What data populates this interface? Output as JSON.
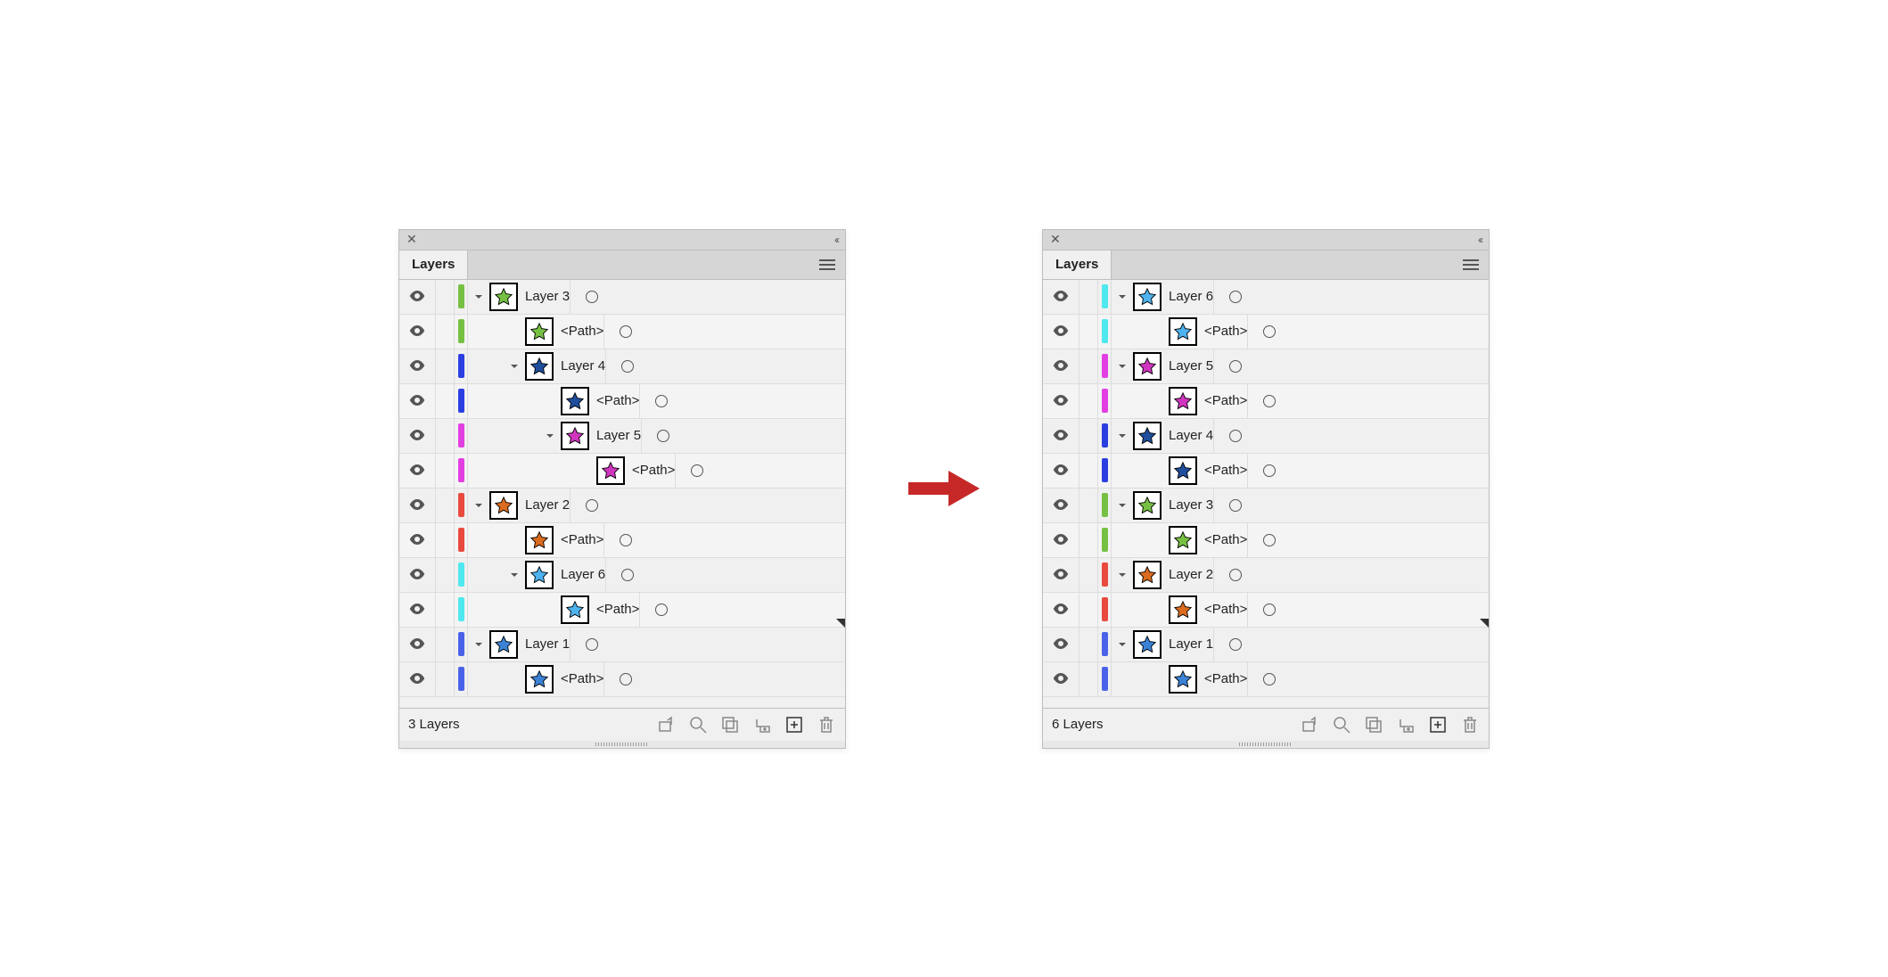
{
  "tab_label": "Layers",
  "path_label": "<Path>",
  "panels": [
    {
      "footer": "3 Layers",
      "corner_row_index": 10,
      "rows": [
        {
          "indent": 0,
          "disclosure": true,
          "label": "Layer 3",
          "color": "#76c043",
          "star": "#76c043"
        },
        {
          "indent": 1,
          "disclosure": false,
          "label": "<Path>",
          "color": "#76c043",
          "star": "#76c043"
        },
        {
          "indent": 1,
          "disclosure": true,
          "label": "Layer 4",
          "color": "#2b3fe0",
          "star": "#1f4e9c"
        },
        {
          "indent": 2,
          "disclosure": false,
          "label": "<Path>",
          "color": "#2b3fe0",
          "star": "#1f4e9c"
        },
        {
          "indent": 2,
          "disclosure": true,
          "label": "Layer 5",
          "color": "#e23fe2",
          "star": "#d035c0"
        },
        {
          "indent": 3,
          "disclosure": false,
          "label": "<Path>",
          "color": "#e23fe2",
          "star": "#d035c0"
        },
        {
          "indent": 0,
          "disclosure": true,
          "label": "Layer 2",
          "color": "#e84a3f",
          "star": "#db6b1e"
        },
        {
          "indent": 1,
          "disclosure": false,
          "label": "<Path>",
          "color": "#e84a3f",
          "star": "#db6b1e"
        },
        {
          "indent": 1,
          "disclosure": true,
          "label": "Layer 6",
          "color": "#4fe8ee",
          "star": "#4db2ee"
        },
        {
          "indent": 2,
          "disclosure": false,
          "label": "<Path>",
          "color": "#4fe8ee",
          "star": "#4db2ee"
        },
        {
          "indent": 0,
          "disclosure": true,
          "label": "Layer 1",
          "color": "#4a62e8",
          "star": "#3b82d6"
        },
        {
          "indent": 1,
          "disclosure": false,
          "label": "<Path>",
          "color": "#4a62e8",
          "star": "#3b82d6"
        }
      ]
    },
    {
      "footer": "6 Layers",
      "corner_row_index": 10,
      "rows": [
        {
          "indent": 0,
          "disclosure": true,
          "label": "Layer 6",
          "color": "#4fe8ee",
          "star": "#4db2ee"
        },
        {
          "indent": 1,
          "disclosure": false,
          "label": "<Path>",
          "color": "#4fe8ee",
          "star": "#4db2ee"
        },
        {
          "indent": 0,
          "disclosure": true,
          "label": "Layer 5",
          "color": "#e23fe2",
          "star": "#d035c0"
        },
        {
          "indent": 1,
          "disclosure": false,
          "label": "<Path>",
          "color": "#e23fe2",
          "star": "#d035c0"
        },
        {
          "indent": 0,
          "disclosure": true,
          "label": "Layer 4",
          "color": "#2b3fe0",
          "star": "#1f4e9c"
        },
        {
          "indent": 1,
          "disclosure": false,
          "label": "<Path>",
          "color": "#2b3fe0",
          "star": "#1f4e9c"
        },
        {
          "indent": 0,
          "disclosure": true,
          "label": "Layer 3",
          "color": "#76c043",
          "star": "#76c043"
        },
        {
          "indent": 1,
          "disclosure": false,
          "label": "<Path>",
          "color": "#76c043",
          "star": "#76c043"
        },
        {
          "indent": 0,
          "disclosure": true,
          "label": "Layer 2",
          "color": "#e84a3f",
          "star": "#db6b1e"
        },
        {
          "indent": 1,
          "disclosure": false,
          "label": "<Path>",
          "color": "#e84a3f",
          "star": "#db6b1e"
        },
        {
          "indent": 0,
          "disclosure": true,
          "label": "Layer 1",
          "color": "#4a62e8",
          "star": "#3b82d6"
        },
        {
          "indent": 1,
          "disclosure": false,
          "label": "<Path>",
          "color": "#4a62e8",
          "star": "#3b82d6"
        }
      ]
    }
  ],
  "arrow_color": "#c62828"
}
